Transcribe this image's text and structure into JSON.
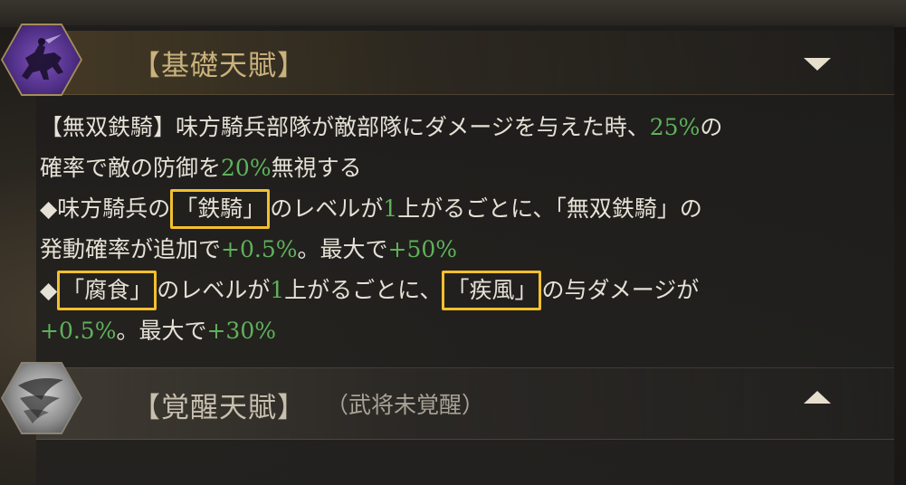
{
  "sections": {
    "basic": {
      "title": "【基礎天賦】",
      "icon": "cavalry-rider-icon",
      "collapse_icon": "triangle-down-icon"
    },
    "awaken": {
      "title": "【覚醒天賦】",
      "subtitle": "（武将未覚醒）",
      "icon": "wing-emblem-icon",
      "expand_icon": "triangle-up-icon"
    }
  },
  "description": {
    "line1": {
      "a": "【無双鉄騎】味方騎兵部隊が敵部隊にダメージを与えた時、",
      "b": "25%",
      "c": "の"
    },
    "line2": {
      "a": "確率で敵の防御を",
      "b": "20%",
      "c": "無視する"
    },
    "line3": {
      "a": "◆味方騎兵の",
      "box": "「鉄騎」",
      "b": "のレベルが",
      "c": "1",
      "d": "上がるごとに、「無双鉄騎」の"
    },
    "line4": {
      "a": "発動確率が追加で",
      "b": "+0.5%",
      "c": "。最大で",
      "d": "+50%"
    },
    "line5": {
      "a": "◆",
      "box1": "「腐食」",
      "b": "のレベルが",
      "c": "1",
      "d": "上がるごとに、",
      "box2": "「疾風」",
      "e": "の与ダメージが"
    },
    "line6": {
      "a": "+0.5%",
      "b": "。最大で",
      "c": "+30%"
    }
  },
  "colors": {
    "highlight_green": "#5fb15b",
    "box_yellow": "#f3bf2e",
    "title_gold": "#c9b27c"
  }
}
